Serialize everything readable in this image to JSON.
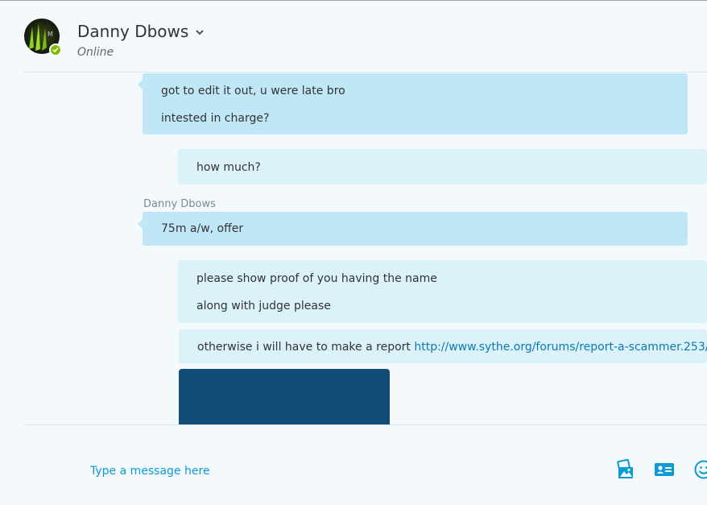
{
  "header": {
    "contact_name": "Danny Dbows",
    "status": "Online",
    "presence_color": "#7fba00"
  },
  "messages": [
    {
      "direction": "in",
      "lines": [
        "got to edit it out, u were late bro",
        "intested in charge?"
      ]
    },
    {
      "direction": "out",
      "lines": [
        "how much?"
      ]
    },
    {
      "direction": "in",
      "sender": "Danny Dbows",
      "lines": [
        "75m a/w, offer"
      ]
    },
    {
      "direction": "out",
      "lines": [
        "please show proof of you having the name",
        "along with judge please"
      ]
    },
    {
      "direction": "out",
      "text": "otherwise i will have to make a report ",
      "link": "http://www.sythe.org/forums/report-a-scammer.253/"
    },
    {
      "direction": "out",
      "type": "image"
    }
  ],
  "compose": {
    "placeholder": "Type a message here"
  },
  "toolbar": {
    "icons": [
      "image-share-icon",
      "contact-card-icon",
      "emoticon-icon"
    ]
  },
  "colors": {
    "accent": "#0a9ad6",
    "incoming_bubble": "#c0e7f8",
    "outgoing_bubble": "#dbf2fb",
    "link": "#0a7ab0"
  }
}
